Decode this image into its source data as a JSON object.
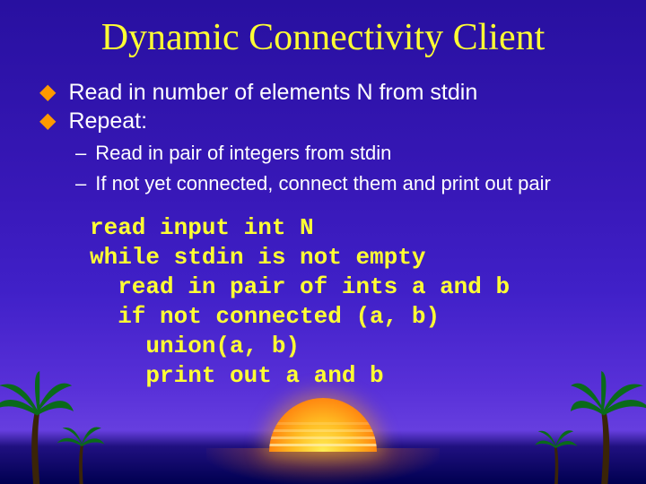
{
  "title": "Dynamic Connectivity Client",
  "bullets": {
    "b1": "Read in number of elements N from stdin",
    "b2": "Repeat:"
  },
  "subs": {
    "s1": "Read in pair of integers from stdin",
    "s2": "If not yet connected, connect them and print out pair"
  },
  "code": {
    "l1": "read input int N",
    "l2": "while stdin is not empty",
    "l3": "  read in pair of ints a and b",
    "l4": "  if not connected (a, b)",
    "l5": "    union(a, b)",
    "l6": "    print out a and b"
  }
}
